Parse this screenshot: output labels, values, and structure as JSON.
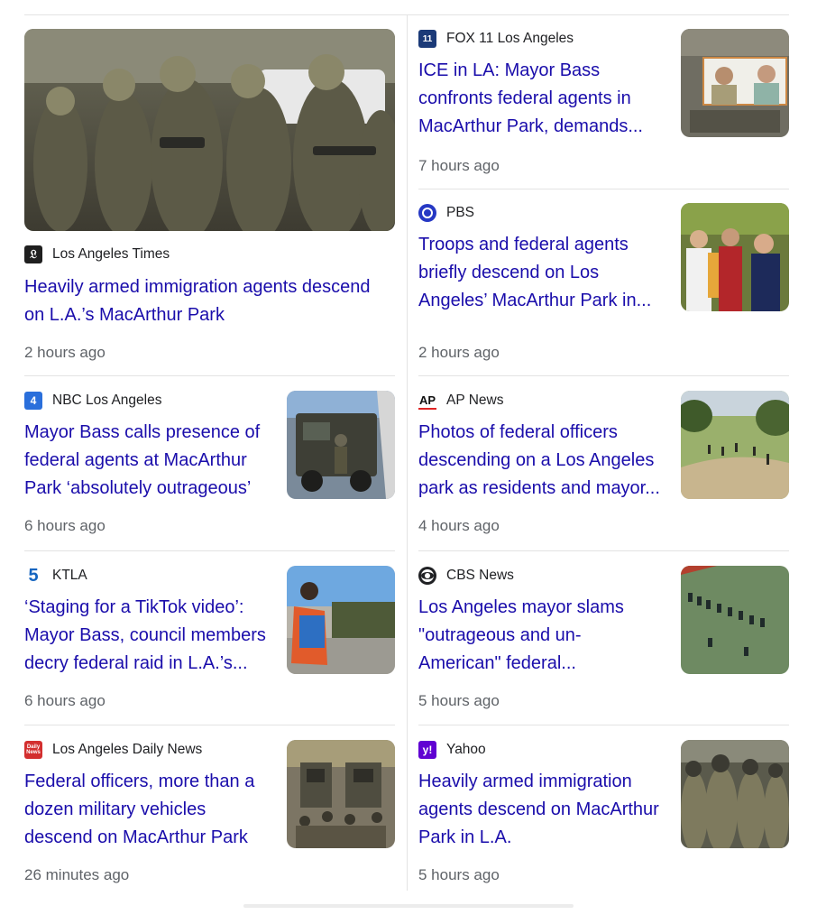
{
  "articles": [
    {
      "source": "Los Angeles Times",
      "title": "Heavily armed immigration agents descend on L.A.’s MacArthur Park",
      "time": "2 hours ago",
      "logo_icon": "la-times-logo-icon",
      "thumb": "armed-agents-photo"
    },
    {
      "source": "FOX 11 Los Angeles",
      "title": "ICE in LA: Mayor Bass confronts federal agents in MacArthur Park, demands...",
      "time": "7 hours ago",
      "logo_icon": "fox11-logo-icon",
      "thumb": "aerial-news-photo"
    },
    {
      "source": "PBS",
      "title": "Troops and federal agents briefly descend on Los Angeles’ MacArthur Park in...",
      "time": "2 hours ago",
      "logo_icon": "pbs-logo-icon",
      "thumb": "protest-crowd-photo"
    },
    {
      "source": "NBC Los Angeles",
      "title": "Mayor Bass calls presence of federal agents at MacArthur Park ‘absolutely outrageous’",
      "time": "6 hours ago",
      "logo_icon": "nbc-la-logo-icon",
      "thumb": "military-vehicle-photo"
    },
    {
      "source": "AP News",
      "title": "Photos of federal officers descending on a Los Angeles park as residents and mayor...",
      "time": "4 hours ago",
      "logo_icon": "ap-logo-icon",
      "logo_text": "AP",
      "thumb": "park-overview-photo"
    },
    {
      "source": "KTLA",
      "title": "‘Staging for a TikTok video’: Mayor Bass, council members decry federal raid in L.A.’s...",
      "time": "6 hours ago",
      "logo_icon": "ktla-logo-icon",
      "logo_text": "5",
      "thumb": "protester-sign-photo"
    },
    {
      "source": "CBS News",
      "title": "Los Angeles mayor slams \"outrageous and un-American\" federal...",
      "time": "5 hours ago",
      "logo_icon": "cbs-logo-icon",
      "thumb": "field-formation-photo"
    },
    {
      "source": "Los Angeles Daily News",
      "title": "Federal officers, more than a dozen military vehicles descend on MacArthur Park",
      "time": "26 minutes ago",
      "logo_icon": "daily-news-logo-icon",
      "logo_text": "Daily News",
      "thumb": "military-convoy-photo"
    },
    {
      "source": "Yahoo",
      "title": "Heavily armed immigration agents descend on MacArthur Park in L.A.",
      "time": "5 hours ago",
      "logo_icon": "yahoo-logo-icon",
      "logo_text": "y!",
      "thumb": "tactical-team-photo"
    }
  ],
  "colors": {
    "title_link": "#1a0dab",
    "source_text": "#202124",
    "timestamp": "#5f6368",
    "divider": "#e3e3e3",
    "la_times": "#1f1f1f",
    "fox11": "#1b3a78",
    "pbs": "#2638c4",
    "nbc": "#2a6fdb",
    "ap": "#e02424",
    "ktla": "#1565c0",
    "cbs": "#202124",
    "daily_news": "#d32f2f",
    "yahoo": "#6001d2"
  }
}
